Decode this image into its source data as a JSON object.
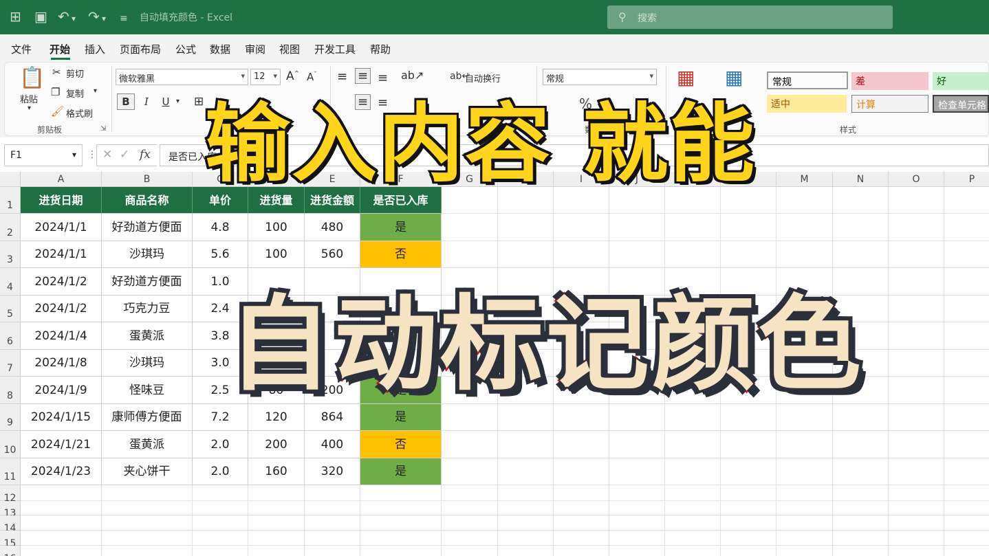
{
  "titlebar": {
    "doc_title": "自动填充颜色 - Excel",
    "search_placeholder": "搜索"
  },
  "menu": [
    "文件",
    "开始",
    "插入",
    "页面布局",
    "公式",
    "数据",
    "审阅",
    "视图",
    "开发工具",
    "帮助"
  ],
  "ribbon": {
    "clipboard": {
      "paste": "粘贴",
      "cut": "剪切",
      "copy": "复制",
      "format_painter": "格式刷",
      "group_label": "剪贴板"
    },
    "font": {
      "font_name": "微软雅黑",
      "font_size": "12",
      "bold": "B",
      "italic": "I",
      "underline": "U"
    },
    "alignment": {
      "wrap_text": "自动换行"
    },
    "number": {
      "format": "常规",
      "percent": "%",
      "group_label": "数字"
    },
    "styles": {
      "group_label": "样式",
      "cells": [
        {
          "label": "常规",
          "bg": "#ffffff",
          "fg": "#222222"
        },
        {
          "label": "差",
          "bg": "#f4c7ce",
          "fg": "#9c0006"
        },
        {
          "label": "好",
          "bg": "#c6efce",
          "fg": "#006100"
        },
        {
          "label": "适中",
          "bg": "#ffeb9c",
          "fg": "#9c5700"
        },
        {
          "label": "计算",
          "bg": "#f2f2f2",
          "fg": "#fa7d00"
        },
        {
          "label": "检查单元格",
          "bg": "#a5a5a5",
          "fg": "#ffffff"
        }
      ]
    }
  },
  "formula_bar": {
    "name_box": "F1",
    "fx": "fx",
    "content": "是否已入库"
  },
  "columns": [
    "A",
    "B",
    "C",
    "D",
    "E",
    "F",
    "G",
    "H",
    "I",
    "J",
    "K",
    "L",
    "M",
    "N",
    "O",
    "P"
  ],
  "rows": [
    "1",
    "2",
    "3",
    "4",
    "5",
    "6",
    "7",
    "8",
    "9",
    "10",
    "11",
    "12",
    "13",
    "14",
    "15",
    "16"
  ],
  "table": {
    "headers": [
      "进货日期",
      "商品名称",
      "单价",
      "进货量",
      "进货金额",
      "是否已入库"
    ],
    "rows": [
      [
        "2024/1/1",
        "好劲道方便面",
        "4.8",
        "100",
        "480",
        "是"
      ],
      [
        "2024/1/1",
        "沙琪玛",
        "5.6",
        "100",
        "560",
        "否"
      ],
      [
        "2024/1/2",
        "好劲道方便面",
        "1.0",
        "",
        "",
        ""
      ],
      [
        "2024/1/2",
        "巧克力豆",
        "2.4",
        "",
        "",
        ""
      ],
      [
        "2024/1/4",
        "蛋黄派",
        "3.8",
        "",
        "",
        ""
      ],
      [
        "2024/1/8",
        "沙琪玛",
        "3.0",
        "",
        "",
        ""
      ],
      [
        "2024/1/9",
        "怪味豆",
        "2.5",
        "80",
        "200",
        "是"
      ],
      [
        "2024/1/15",
        "康师傅方便面",
        "7.2",
        "120",
        "864",
        "是"
      ],
      [
        "2024/1/21",
        "蛋黄派",
        "2.0",
        "200",
        "400",
        "否"
      ],
      [
        "2024/1/23",
        "夹心饼干",
        "2.0",
        "160",
        "320",
        "是"
      ]
    ]
  },
  "status_colors": {
    "yes": "#70ad47",
    "no": "#ffc000",
    "header": "#1f6f43"
  },
  "overlay": {
    "line1": "输入内容 就能",
    "line2": "自动标记颜色"
  }
}
